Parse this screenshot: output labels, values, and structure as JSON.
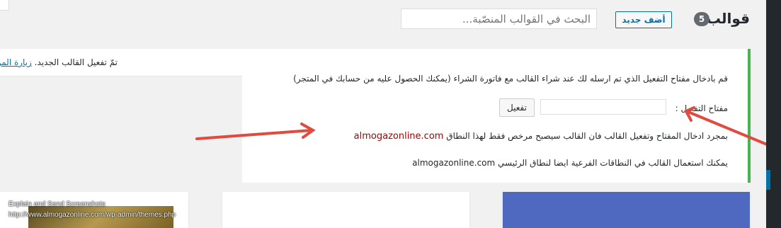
{
  "header": {
    "title": "قوالب",
    "count": "5",
    "add_new_label": "أضف جديد",
    "search_placeholder": "البحث في القوالب المنصّبة..."
  },
  "notice": {
    "text": "تمّ تفعيل القالب الجديد.",
    "link": "زيارة الموقع"
  },
  "activation": {
    "intro": "قم بادخال مفتاح التفعيل الذي تم ارسله لك عند شراء القالب مع فاتورة الشراء (يمكنك الحصول عليه من حسابك في المتجر)",
    "key_label": "مفتاح التفعيل :",
    "button_label": "تفعيل",
    "license_text": "بمجرد ادخال المفتاح وتفعيل القالب فان القالب سيصبح مرخص فقط لهذا النطاق",
    "domain": "almogazonline.com",
    "subdomain_text": "يمكنك استعمال القالب في النطاقات الفرعية ايضا لنطاق الرئيسي",
    "domain2": "almogazonline.com"
  },
  "overlay": {
    "line1": "Explain and Send Screenshots",
    "line2": "http://www.almogazonline.com/wp-admin/themes.php"
  },
  "colors": {
    "accent": "#0073aa",
    "success_border": "#46b450",
    "arrow": "#e04a3f",
    "domain_text": "#aa0000"
  }
}
